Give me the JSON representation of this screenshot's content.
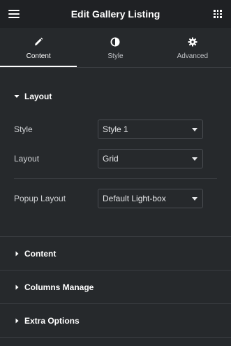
{
  "header": {
    "title": "Edit Gallery Listing",
    "menu_icon": "hamburger-icon",
    "apps_icon": "grid-icon"
  },
  "tabs": [
    {
      "label": "Content",
      "icon": "pencil-icon",
      "active": true
    },
    {
      "label": "Style",
      "icon": "half-circle-icon",
      "active": false
    },
    {
      "label": "Advanced",
      "icon": "gear-icon",
      "active": false
    }
  ],
  "sections": {
    "layout": {
      "title": "Layout",
      "expanded": true,
      "fields": {
        "style": {
          "label": "Style",
          "value": "Style 1"
        },
        "layout": {
          "label": "Layout",
          "value": "Grid"
        },
        "popup_layout": {
          "label": "Popup Layout",
          "value": "Default Light-box"
        }
      }
    },
    "content": {
      "title": "Content",
      "expanded": false
    },
    "columns_manage": {
      "title": "Columns Manage",
      "expanded": false
    },
    "extra_options": {
      "title": "Extra Options",
      "expanded": false
    }
  },
  "colors": {
    "header_bg": "#1f2124",
    "panel_bg": "#26292c",
    "divider": "#3a3d41",
    "text": "#ffffff"
  }
}
